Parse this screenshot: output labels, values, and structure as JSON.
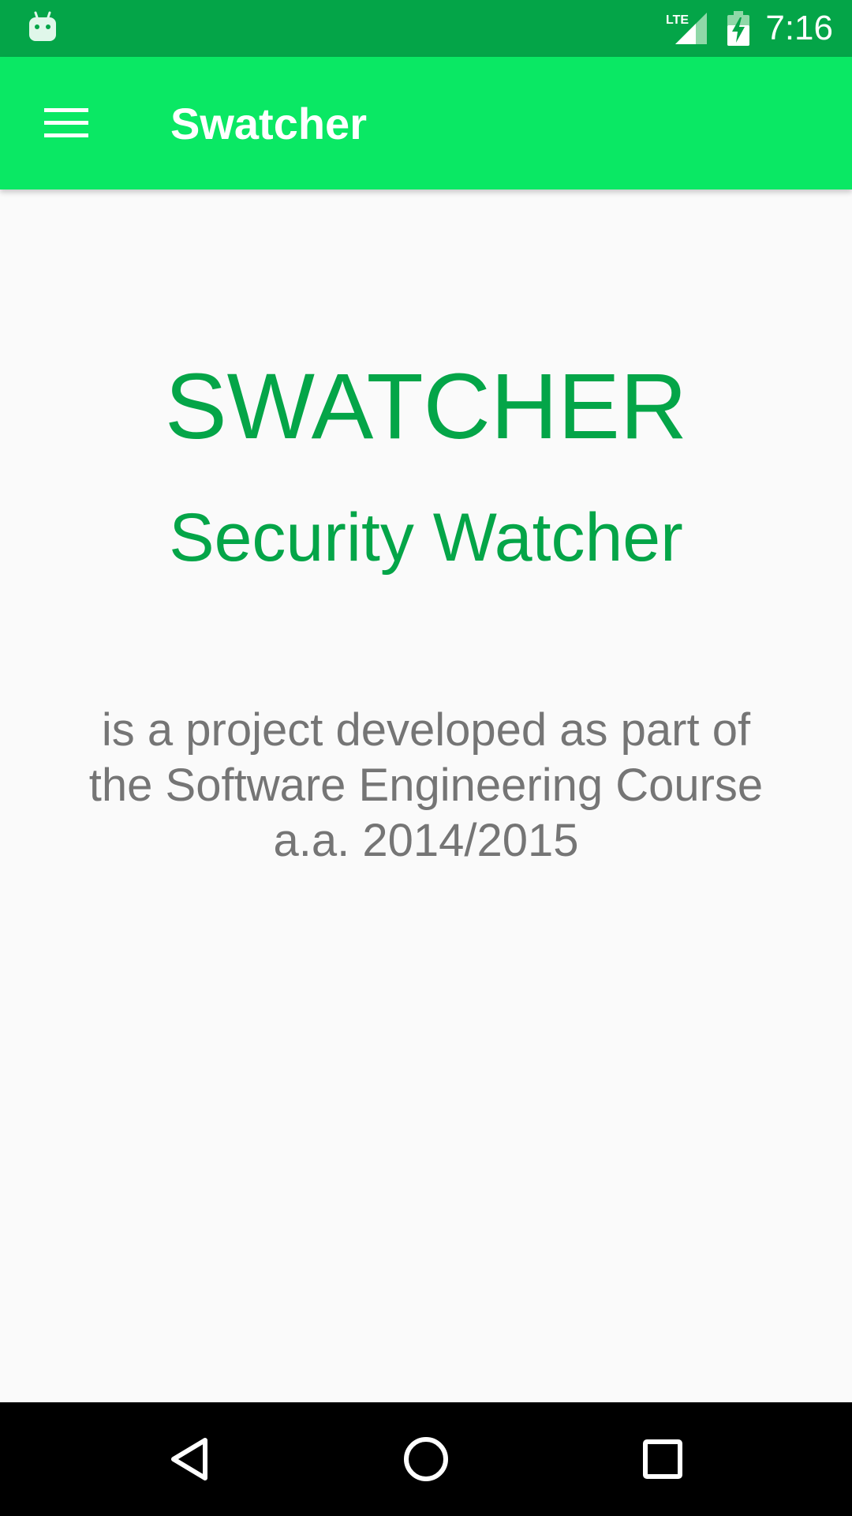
{
  "status_bar": {
    "time": "7:16",
    "network_label": "LTE",
    "icons": [
      "android-icon",
      "signal-icon",
      "battery-charging-icon"
    ]
  },
  "app_bar": {
    "title": "Swatcher",
    "menu_icon": "hamburger-menu-icon"
  },
  "main": {
    "title": "SWATCHER",
    "subtitle": "Security Watcher",
    "description_lines": [
      "is a project developed as part of",
      "the Software Engineering Course",
      "a.a. 2014/2015"
    ]
  },
  "navigation_bar": {
    "icons": [
      "back-icon",
      "home-icon",
      "recents-icon"
    ]
  },
  "colors": {
    "status_bar": "#04a548",
    "app_bar": "#0ae864",
    "accent_text": "#04a548",
    "body_text": "#757575",
    "background": "#fafafa",
    "nav_bar": "#000000"
  }
}
